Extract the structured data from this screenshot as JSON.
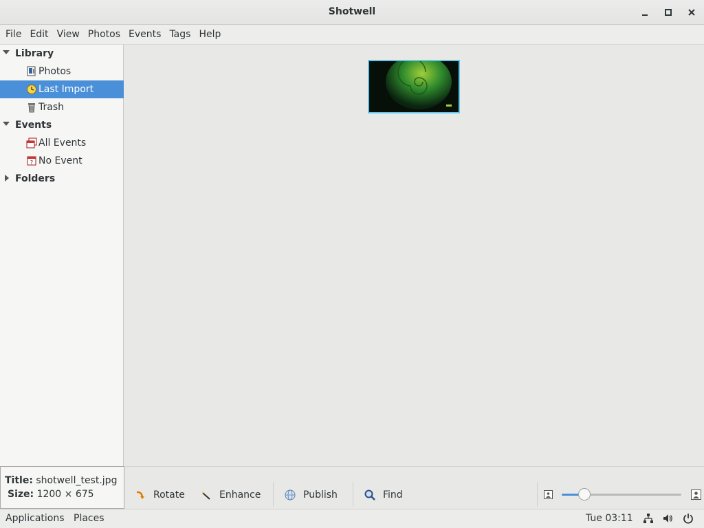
{
  "window": {
    "title": "Shotwell"
  },
  "menubar": {
    "items": [
      "File",
      "Edit",
      "View",
      "Photos",
      "Events",
      "Tags",
      "Help"
    ]
  },
  "sidebar": {
    "library_header": "Library",
    "library_items": [
      {
        "label": "Photos",
        "icon": "photos-icon"
      },
      {
        "label": "Last Import",
        "icon": "last-import-clock-icon",
        "selected": true
      },
      {
        "label": "Trash",
        "icon": "trash-icon"
      }
    ],
    "events_header": "Events",
    "events_items": [
      {
        "label": "All Events",
        "icon": "all-events-icon"
      },
      {
        "label": "No Event",
        "icon": "no-event-icon"
      }
    ],
    "folders_header": "Folders"
  },
  "info": {
    "title_key": "Title:",
    "title_value": "shotwell_test.jpg",
    "size_key": "Size:",
    "size_value": "1200 × 675"
  },
  "toolbar": {
    "rotate": "Rotate",
    "enhance": "Enhance",
    "publish": "Publish",
    "find": "Find",
    "zoom_level": 0.19
  },
  "panel": {
    "applications": "Applications",
    "places": "Places",
    "clock": "Tue 03:11"
  },
  "colors": {
    "selection": "#4a90d9",
    "thumb_border": "#62c7ee"
  }
}
